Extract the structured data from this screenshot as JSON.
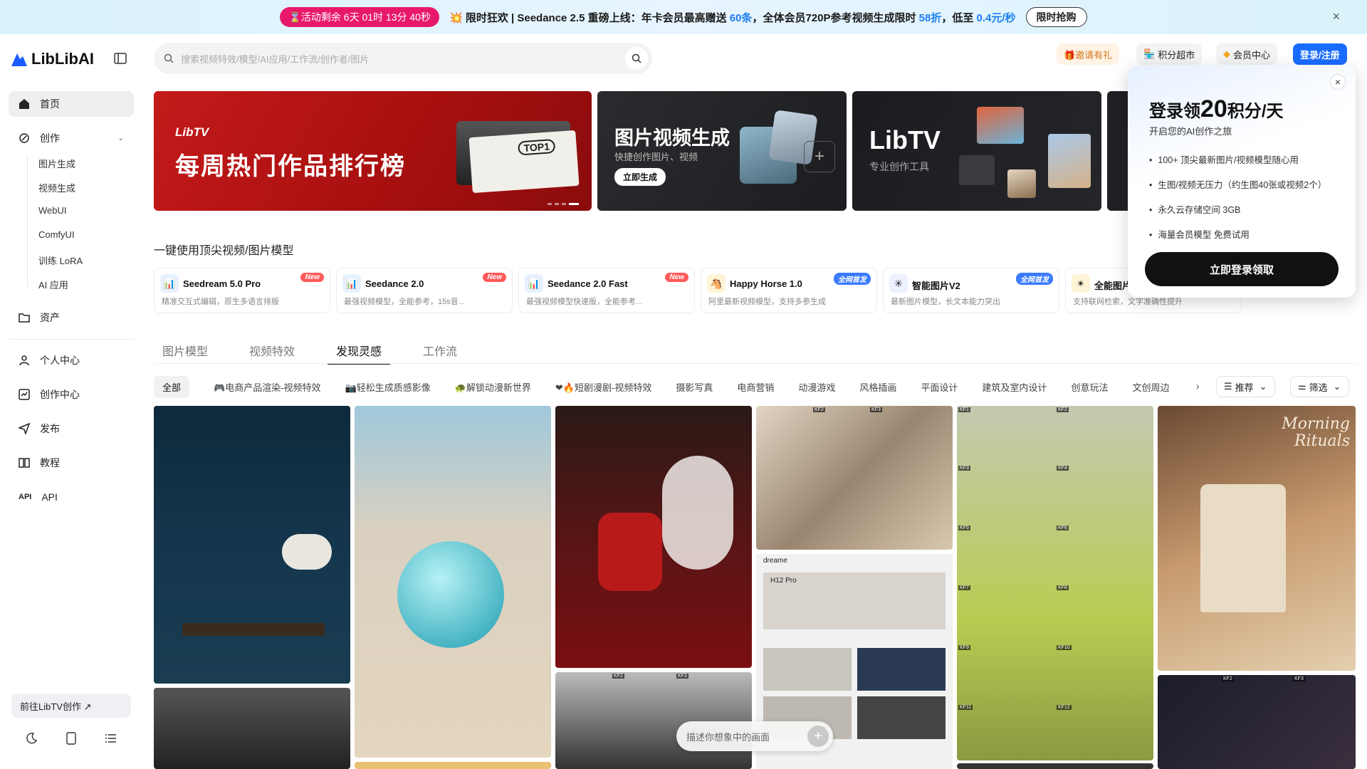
{
  "promo": {
    "countdown": "⌛活动剩余  6天  01时 13分 40秒",
    "msg_prefix": "💥 限时狂欢 | Seedance 2.5 重磅上线：年卡会员最高赠送 ",
    "hl1": "60条",
    "msg_mid": "，全体会员720P参考视频生成限时 ",
    "hl2": "58折",
    "msg_mid2": "，低至 ",
    "hl3": "0.4元/秒",
    "buy_label": "限时抢购",
    "close": "×"
  },
  "sidebar": {
    "logo": "LibLibAI",
    "home": "首页",
    "create": "创作",
    "sub": [
      "图片生成",
      "视频生成",
      "WebUI",
      "ComfyUI",
      "训练 LoRA",
      "AI 应用"
    ],
    "assets": "资产",
    "personal": "个人中心",
    "studio": "创作中心",
    "publish": "发布",
    "tutorial": "教程",
    "api": "API",
    "libtv": "前往LibTV创作 ↗"
  },
  "search": {
    "placeholder": "搜索视频特效/模型/AI应用/工作流/创作者/图片"
  },
  "header": {
    "invite": "🎁邀请有礼",
    "market": "积分超市",
    "member": "会员中心",
    "login": "登录/注册"
  },
  "banners": {
    "b1_brand": "LibTV",
    "b1_title": "每周热门作品排行榜",
    "b1_top": "TOP1",
    "b2_title": "图片视频生成",
    "b2_sub": "快捷创作图片、视频",
    "b2_btn": "立即生成",
    "b3_title": "LibTV",
    "b3_sub": "专业创作工具"
  },
  "section_title": "一键使用顶尖视频/图片模型",
  "models": [
    {
      "name": "Seedream 5.0 Pro",
      "desc": "精准交互式编辑，原生多语言排版",
      "tag": "New",
      "tagColor": "#ff5a5a",
      "icoBg": "#e8f1ff",
      "ico": "📊"
    },
    {
      "name": "Seedance 2.0",
      "desc": "最强视频模型，全能参考，15s音...",
      "tag": "New",
      "tagColor": "#ff5a5a",
      "icoBg": "#e8f1ff",
      "ico": "📊"
    },
    {
      "name": "Seedance 2.0 Fast",
      "desc": "最强视频模型快速版，全能参考...",
      "tag": "New",
      "tagColor": "#ff5a5a",
      "icoBg": "#e8f1ff",
      "ico": "📊"
    },
    {
      "name": "Happy Horse 1.0",
      "desc": "阿里最新视频模型，支持多参生成",
      "tag": "全网首发",
      "tagColor": "#3a7bff",
      "icoBg": "#fff4d6",
      "ico": "🐴"
    },
    {
      "name": "智能图片V2",
      "desc": "最新图片模型，长文本能力突出",
      "tag": "全网首发",
      "tagColor": "#3a7bff",
      "icoBg": "#eef2ff",
      "ico": "✳"
    },
    {
      "name": "全能图片",
      "desc": "支持联网检索，文字准确性提升",
      "tag": "",
      "tagColor": "#3a7bff",
      "icoBg": "#fff4d6",
      "ico": "✴"
    }
  ],
  "tabs": [
    "图片模型",
    "视频特效",
    "发现灵感",
    "工作流"
  ],
  "categories": [
    "全部",
    "🎮电商产品渲染-视频特效",
    "📷轻松生成质感影像",
    "🐢解锁动漫新世界",
    "❤🔥短剧漫剧-视频特效",
    "摄影写真",
    "电商营销",
    "动漫游戏",
    "风格插画",
    "平面设计",
    "建筑及室内设计",
    "创意玩法",
    "文创周边"
  ],
  "sort": {
    "recommend": "推荐",
    "filter": "筛选"
  },
  "login_popup": {
    "title_pre": "登录领",
    "title_num": "20",
    "title_post": "积分/天",
    "subtitle": "开启您的AI创作之旅",
    "benefits": [
      "100+ 顶尖最新图片/视频模型随心用",
      "生图/视频无压力（约生图40张或视频2个）",
      "永久云存储空间 3GB",
      "海量会员模型 免费试用"
    ],
    "button": "立即登录领取"
  },
  "prompt": {
    "placeholder": "描述你想象中的画面"
  },
  "grid_text": {
    "morning": "Morning Rituals",
    "dreame": "dreame",
    "h12": "H12 Pro",
    "kf": [
      "KF1",
      "KF2",
      "KF3",
      "KF4",
      "KF5",
      "KF6",
      "KF7",
      "KF8",
      "KF9",
      "KF10",
      "KF11",
      "KF12"
    ]
  }
}
